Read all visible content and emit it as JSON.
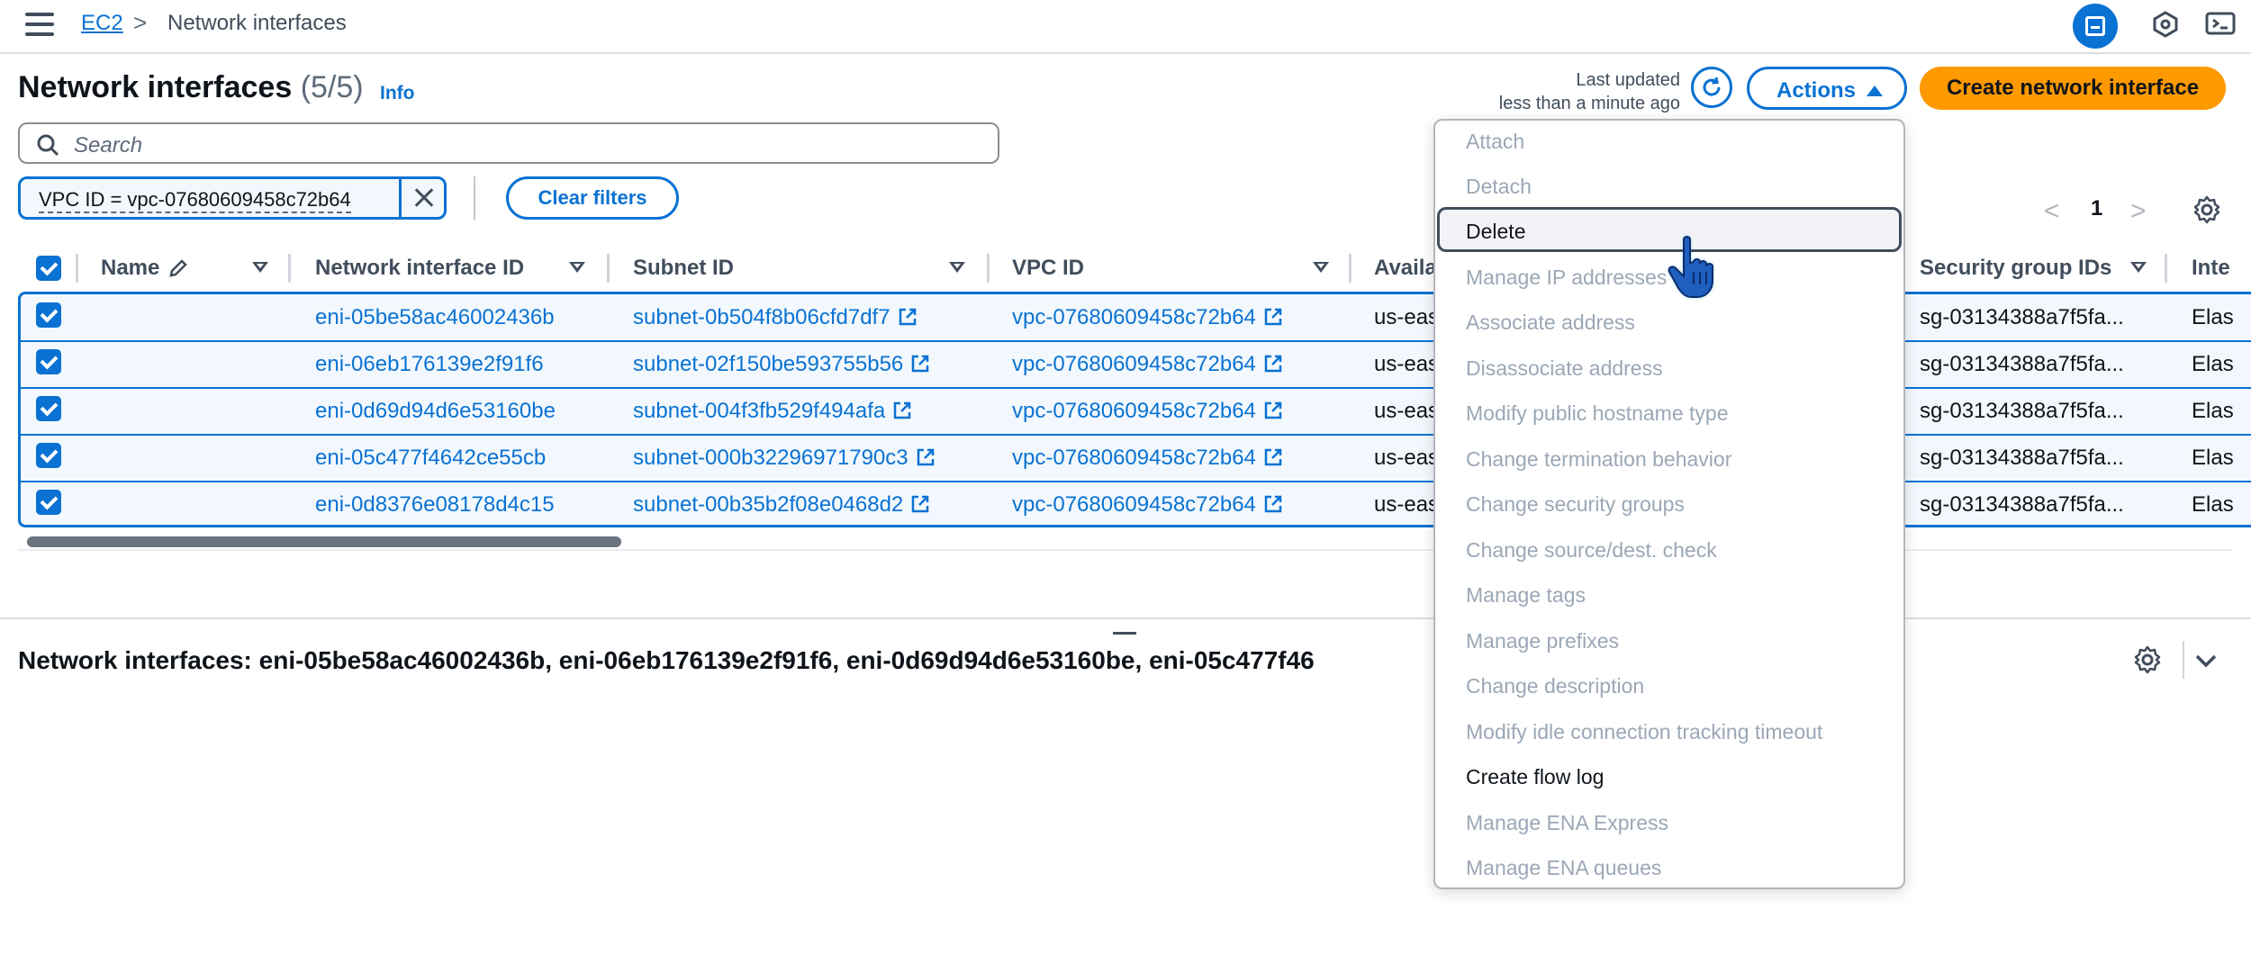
{
  "breadcrumb": {
    "root": "EC2",
    "separator": ">",
    "current": "Network interfaces"
  },
  "header": {
    "title": "Network interfaces",
    "count": "(5/5)",
    "info": "Info",
    "last_updated_line1": "Last updated",
    "last_updated_line2": "less than a minute ago",
    "actions_label": "Actions",
    "create_label": "Create network interface"
  },
  "search": {
    "placeholder": "Search"
  },
  "filter": {
    "token": "VPC ID = vpc-07680609458c72b64",
    "clear_label": "Clear filters"
  },
  "pagination": {
    "prev": "<",
    "page": "1",
    "next": ">"
  },
  "table": {
    "columns": [
      "Name",
      "Network interface ID",
      "Subnet ID",
      "VPC ID",
      "Availa",
      "Security group IDs",
      "Inte"
    ],
    "rows": [
      {
        "interface_id": "eni-05be58ac46002436b",
        "subnet_id": "subnet-0b504f8b06cfd7df7",
        "vpc_id": "vpc-07680609458c72b64",
        "az": "us-eas",
        "sg": "sg-03134388a7f5fa...",
        "iface": "Elas"
      },
      {
        "interface_id": "eni-06eb176139e2f91f6",
        "subnet_id": "subnet-02f150be593755b56",
        "vpc_id": "vpc-07680609458c72b64",
        "az": "us-eas",
        "sg": "sg-03134388a7f5fa...",
        "iface": "Elas"
      },
      {
        "interface_id": "eni-0d69d94d6e53160be",
        "subnet_id": "subnet-004f3fb529f494afa",
        "vpc_id": "vpc-07680609458c72b64",
        "az": "us-eas",
        "sg": "sg-03134388a7f5fa...",
        "iface": "Elas"
      },
      {
        "interface_id": "eni-05c477f4642ce55cb",
        "subnet_id": "subnet-000b32296971790c3",
        "vpc_id": "vpc-07680609458c72b64",
        "az": "us-eas",
        "sg": "sg-03134388a7f5fa...",
        "iface": "Elas"
      },
      {
        "interface_id": "eni-0d8376e08178d4c15",
        "subnet_id": "subnet-00b35b2f08e0468d2",
        "vpc_id": "vpc-07680609458c72b64",
        "az": "us-eas",
        "sg": "sg-03134388a7f5fa...",
        "iface": "Elas"
      }
    ]
  },
  "details": {
    "title": "Network interfaces: eni-05be58ac46002436b, eni-06eb176139e2f91f6, eni-0d69d94d6e53160be, eni-05c477f46"
  },
  "menu": {
    "items": [
      {
        "label": "Attach",
        "enabled": false
      },
      {
        "label": "Detach",
        "enabled": false
      },
      {
        "label": "Delete",
        "enabled": true,
        "hovered": true
      },
      {
        "label": "Manage IP addresses",
        "enabled": false
      },
      {
        "label": "Associate address",
        "enabled": false
      },
      {
        "label": "Disassociate address",
        "enabled": false
      },
      {
        "label": "Modify public hostname type",
        "enabled": false
      },
      {
        "label": "Change termination behavior",
        "enabled": false
      },
      {
        "label": "Change security groups",
        "enabled": false
      },
      {
        "label": "Change source/dest. check",
        "enabled": false
      },
      {
        "label": "Manage tags",
        "enabled": false
      },
      {
        "label": "Manage prefixes",
        "enabled": false
      },
      {
        "label": "Change description",
        "enabled": false
      },
      {
        "label": "Modify idle connection tracking timeout",
        "enabled": false
      },
      {
        "label": "Create flow log",
        "enabled": true
      },
      {
        "label": "Manage ENA Express",
        "enabled": false
      },
      {
        "label": "Manage ENA queues",
        "enabled": false
      }
    ]
  },
  "colors": {
    "accent": "#0972d3",
    "primary_button": "#ff9900",
    "selected_row_bg": "#f2f8fd",
    "disabled_text": "#9ba7b6"
  },
  "icons": [
    "menu-icon",
    "chevron-right-icon",
    "panel-icon",
    "notifications-icon",
    "cloudshell-icon",
    "refresh-icon",
    "search-icon",
    "close-icon",
    "settings-icon",
    "external-link-icon",
    "edit-icon",
    "sort-icon",
    "chevron-down-icon",
    "hand-pointer-icon"
  ]
}
